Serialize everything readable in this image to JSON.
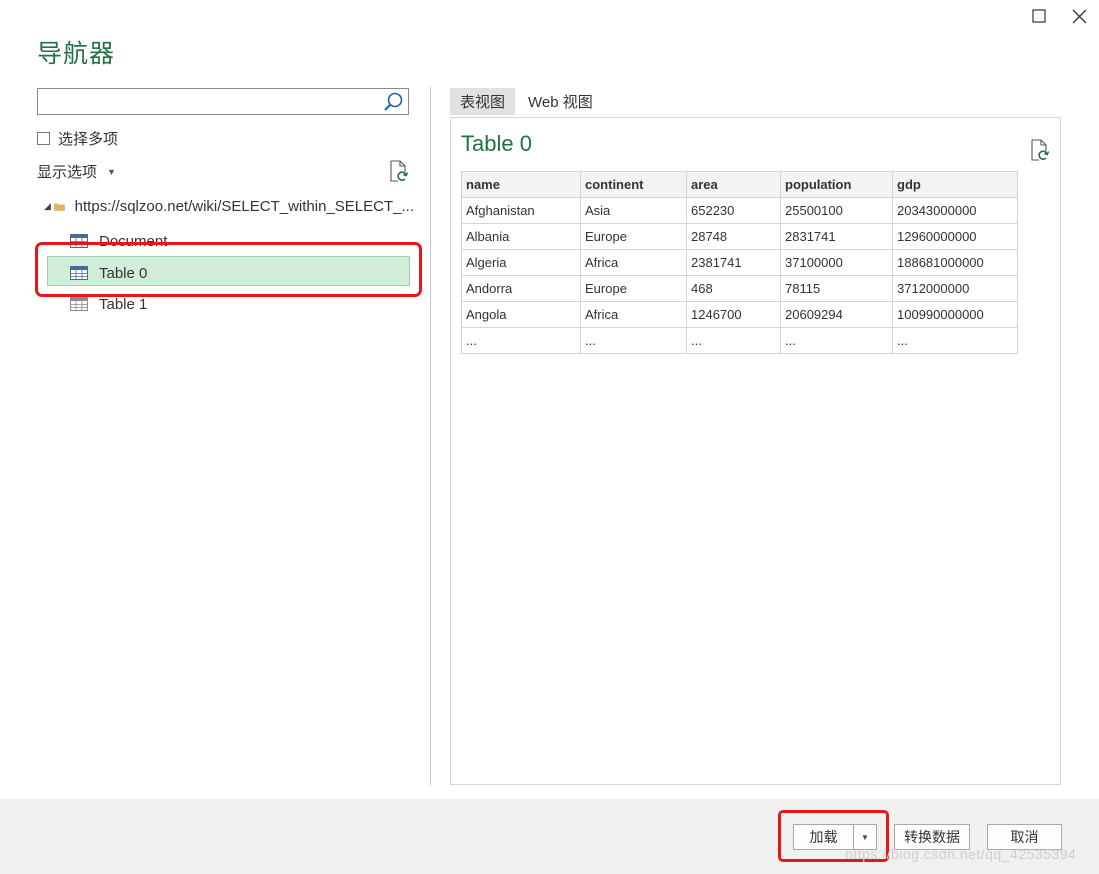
{
  "window": {
    "title": "导航器"
  },
  "search": {
    "value": "",
    "placeholder": ""
  },
  "multi_select": {
    "label": "选择多项",
    "checked": false
  },
  "display_options": {
    "label": "显示选项"
  },
  "tree": {
    "root": {
      "label": "https://sqlzoo.net/wiki/SELECT_within_SELECT_..."
    },
    "items": [
      {
        "label": "Document"
      },
      {
        "label": "Table 0",
        "selected": true
      },
      {
        "label": "Table 1"
      }
    ]
  },
  "tabs": [
    {
      "label": "表视图",
      "active": true
    },
    {
      "label": "Web 视图",
      "active": false
    }
  ],
  "preview": {
    "title": "Table 0",
    "columns": [
      "name",
      "continent",
      "area",
      "population",
      "gdp"
    ],
    "rows": [
      [
        "Afghanistan",
        "Asia",
        "652230",
        "25500100",
        "20343000000"
      ],
      [
        "Albania",
        "Europe",
        "28748",
        "2831741",
        "12960000000"
      ],
      [
        "Algeria",
        "Africa",
        "2381741",
        "37100000",
        "188681000000"
      ],
      [
        "Andorra",
        "Europe",
        "468",
        "78115",
        "3712000000"
      ],
      [
        "Angola",
        "Africa",
        "1246700",
        "20609294",
        "100990000000"
      ],
      [
        "...",
        "...",
        "...",
        "...",
        "..."
      ]
    ]
  },
  "buttons": {
    "load": "加载",
    "transform": "转换数据",
    "cancel": "取消"
  },
  "watermark": "https://blog.csdn.net/qq_42535394",
  "colors": {
    "accent_green": "#217346",
    "selection": "#d1ecd8",
    "highlight_red": "#e81717"
  }
}
